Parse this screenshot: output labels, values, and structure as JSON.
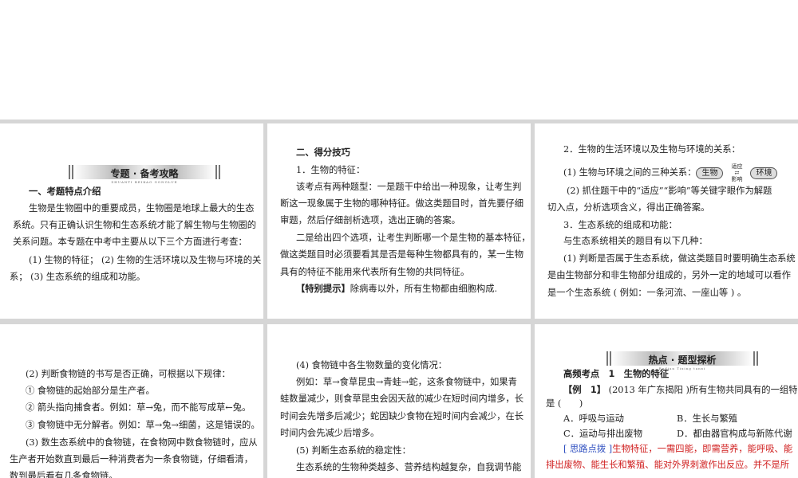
{
  "panel1": {
    "banner_title": "专题 · 备考攻略",
    "banner_sub": "ZHUANTI  BEIKAO GONGLUE",
    "heading": "一、考题特点介绍",
    "lines": [
      "生物是生物圈中的重要成员，生物圈是地球上最大的生态",
      "系统。只有正确认识生物和生态系统才能了解生物与生物圈的",
      "关系问题。本专题在中考中主要从以下三个方面进行考查：",
      "(1) 生物的特征； (2) 生物的生活环境以及生物与环境的关",
      "系； (3) 生态系统的组成和功能。"
    ]
  },
  "panel2": {
    "heading": "二、得分技巧",
    "lines": [
      "1．生物的特征：",
      "该考点有两种题型：一是题干中给出一种现象，让考生判",
      "断这一现象属于生物的哪种特征。做这类题目时，首先要仔细",
      "审题，然后仔细剖析选项，选出正确的答案。",
      "二是给出四个选项，让考生判断哪一个是生物的基本特征，",
      "做这类题目时必须要看其是否是每种生物都具有的，某一生物",
      "具有的特征不能用来代表所有生物的共同特征。"
    ],
    "tip_label": "【特别提示】",
    "tip_text": "除病毒以外，所有生物都由细胞构成."
  },
  "panel3": {
    "line1": "2．生物的生活环境以及生物与环境的关系：",
    "line2": "(1) 生物与环境之间的三种关系：",
    "diagram": {
      "left": "生物",
      "right": "环境",
      "top": "适应",
      "bottom": "影响"
    },
    "lines": [
      "(2) 抓住题干中的“适应”“影响”等关键字眼作为解题",
      "切入点，分析选项含义，得出正确答案。",
      "3．生态系统的组成和功能：",
      "与生态系统相关的题目有以下几种：",
      "(1) 判断是否属于生态系统，做这类题目时要明确生态系统",
      "是由生物部分和非生物部分组成的，另外一定的地域可以看作",
      "是一个生态系统 ( 例如：一条河流、一座山等 ) 。"
    ]
  },
  "panel4": {
    "lines": [
      "(2) 判断食物链的书写是否正确，可根据以下规律：",
      "① 食物链的起始部分是生产者。",
      "② 箭头指向捕食者。例如：草→兔，而不能写成草←兔。",
      "③ 食物链中无分解者。例如：草→兔→细菌，这是错误的。",
      "(3) 数生态系统中的食物链，在食物网中数食物链时，应从",
      "生产者开始数直到最后一种消费者为一条食物链，仔细看清，",
      "数到最后看有几条食物链。"
    ]
  },
  "panel5": {
    "lines": [
      "(4) 食物链中各生物数量的变化情况：",
      "例如：草→食草昆虫→青蛙→蛇，这条食物链中，如果青",
      "蛙数量减少，则食草昆虫会因天敌的减少在短时间内增多，长",
      "时间会先增多后减少；蛇因缺少食物在短时间内会减少，在长",
      "时间内会先减少后增多。",
      "(5) 判断生态系统的稳定性：",
      "生态系统的生物种类越多、营养结构越复杂，自我调节能"
    ]
  },
  "panel6": {
    "banner_title": "热点 · 题型探析",
    "banner_sub": "Redian  Tixing tanxi",
    "heading": "高频考点　1　生物的特征",
    "example_label": "【例　1】",
    "example_source": "(2013 年广东揭阳 )",
    "example_text": "所有生物共同具有的一组特征",
    "example_cont": "是 (　　)",
    "options": [
      "A．呼吸与运动",
      "B．生长与繁殖",
      "C．运动与排出废物",
      "D．都由器官构成与新陈代谢"
    ],
    "hint_label": "[ 思路点拨 ]",
    "hint_line1": "生物特征，一需四能，即需营养，能呼吸、能",
    "hint_line2": "排出废物、能生长和繁殖、能对外界刺激作出反应。并不是所"
  }
}
